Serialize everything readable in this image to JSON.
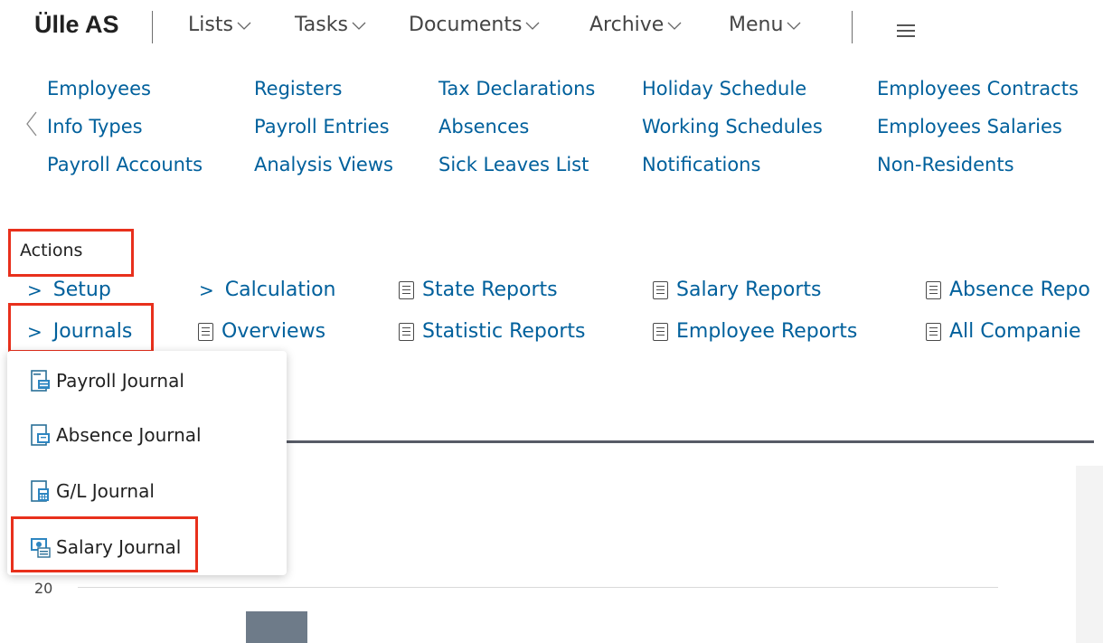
{
  "header": {
    "company": "Ülle AS",
    "menus": [
      {
        "label": "Lists"
      },
      {
        "label": "Tasks"
      },
      {
        "label": "Documents"
      },
      {
        "label": "Archive"
      },
      {
        "label": "Menu"
      }
    ],
    "menu_icon": "hamburger-icon"
  },
  "links": {
    "col1": [
      "Employees",
      "Info Types",
      "Payroll Accounts"
    ],
    "col2": [
      "Registers",
      "Payroll Entries",
      "Analysis Views"
    ],
    "col3": [
      "Tax Declarations",
      "Absences",
      "Sick Leaves List"
    ],
    "col4": [
      "Holiday Schedule",
      "Working Schedules",
      "Notifications"
    ],
    "col5": [
      "Employees Contracts",
      "Employees Salaries",
      "Non-Residents"
    ]
  },
  "actions": {
    "label": "Actions",
    "groups": [
      {
        "label": "Setup",
        "icon": "chevron-right-icon"
      },
      {
        "label": "Journals",
        "icon": "chevron-right-icon"
      },
      {
        "label": "Calculation",
        "icon": "chevron-right-icon"
      },
      {
        "label": "Overviews",
        "icon": "report-icon"
      },
      {
        "label": "State Reports",
        "icon": "report-icon"
      },
      {
        "label": "Statistic Reports",
        "icon": "report-icon"
      },
      {
        "label": "Salary Reports",
        "icon": "report-icon"
      },
      {
        "label": "Employee Reports",
        "icon": "report-icon"
      },
      {
        "label": "Absence Repo",
        "icon": "report-icon"
      },
      {
        "label": "All Companie",
        "icon": "report-icon"
      }
    ]
  },
  "dropdown": {
    "items": [
      {
        "label": "Payroll Journal",
        "icon": "payroll-journal-icon"
      },
      {
        "label": "Absence Journal",
        "icon": "absence-journal-icon"
      },
      {
        "label": "G/L Journal",
        "icon": "gl-journal-icon"
      },
      {
        "label": "Salary Journal",
        "icon": "salary-journal-icon"
      }
    ]
  },
  "chart": {
    "tick_label": "20"
  },
  "colors": {
    "link": "#00609c",
    "highlight": "#e8301c",
    "bar": "#6e7b89"
  }
}
